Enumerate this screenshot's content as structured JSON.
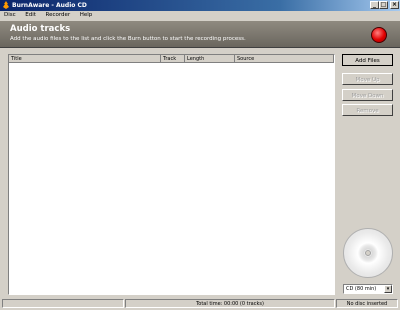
{
  "window": {
    "title": "BurnAware - Audio CD",
    "minimize_glyph": "_",
    "maximize_glyph": "□",
    "close_glyph": "×"
  },
  "menu": {
    "items": [
      "Disc",
      "Edit",
      "Recorder",
      "Help"
    ]
  },
  "header": {
    "title": "Audio tracks",
    "description": "Add the audio files to the list and click the Burn button to start the recording process.",
    "record_button_icon": "record-icon",
    "record_color": "#e00000"
  },
  "track_list": {
    "columns": [
      "Title",
      "Track",
      "Length",
      "Source"
    ],
    "rows": []
  },
  "side_buttons": {
    "add_files": "Add Files",
    "move_up": "Move Up",
    "move_down": "Move Down",
    "remove": "Remove"
  },
  "disc": {
    "icon": "cd-icon",
    "capacity_selected": "CD (80 min)",
    "dropdown_arrow": "▾"
  },
  "status": {
    "summary": "Total time: 00:00 (0 tracks)",
    "left_text": "",
    "right_text": "No disc inserted"
  },
  "colors": {
    "title_bar": "#0a246a",
    "header_bg": "#7d7870",
    "window_bg": "#d4d0c8"
  }
}
